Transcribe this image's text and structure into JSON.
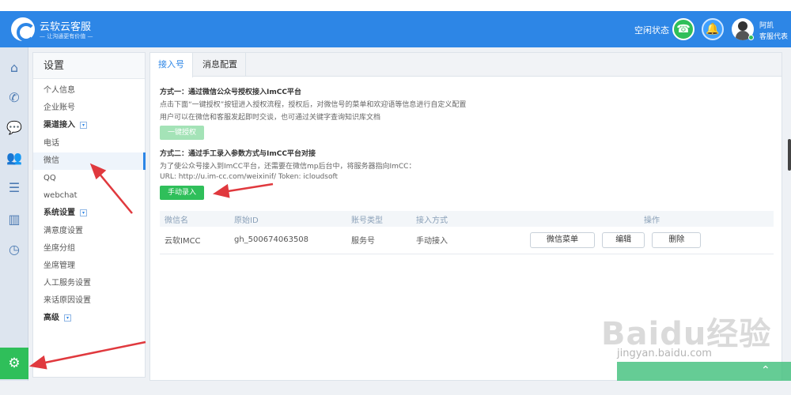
{
  "header": {
    "brand": "云软云客服",
    "slogan": "— 让沟通更有价值 —",
    "status": "空闲状态",
    "user_name": "阿凯",
    "user_role": "客服代表",
    "accent": "#2d86e6",
    "green": "#2fbf5a"
  },
  "rail": {
    "icons": [
      "home-icon",
      "phone-icon",
      "chat-icon",
      "users-icon",
      "list-icon",
      "chart-icon",
      "compass-icon",
      "gear-icon"
    ]
  },
  "sidebar": {
    "title": "设置",
    "items": [
      {
        "label": "个人信息"
      },
      {
        "label": "企业账号"
      },
      {
        "label": "渠道接入"
      },
      {
        "label": "电话"
      },
      {
        "label": "微信"
      },
      {
        "label": "QQ"
      },
      {
        "label": "webchat"
      },
      {
        "label": "系统设置"
      },
      {
        "label": "满意度设置"
      },
      {
        "label": "坐席分组"
      },
      {
        "label": "坐席管理"
      },
      {
        "label": "人工服务设置"
      },
      {
        "label": "来话原因设置"
      },
      {
        "label": "高级"
      }
    ]
  },
  "tabs": [
    {
      "label": "接入号"
    },
    {
      "label": "消息配置"
    }
  ],
  "method1": {
    "title": "方式一：通过微信公众号授权接入ImCC平台",
    "line1": "点击下面“一键授权”按钮进入授权流程，授权后，对微信号的菜单和欢迎语等信息进行自定义配置",
    "line2": "用户可以在微信和客服发起即时交谈，也可通过关键字查询知识库文档",
    "button": "一键授权"
  },
  "method2": {
    "title": "方式二：通过手工录入参数方式与ImCC平台对接",
    "line1": "为了使公众号接入到ImCC平台，还需要在微信mp后台中，将服务器指向ImCC：",
    "url": "URL: http://u.im-cc.com/weixinif/     Token: icloudsoft",
    "button": "手动录入"
  },
  "table": {
    "headers": [
      "微信名",
      "原始ID",
      "账号类型",
      "接入方式",
      "操作"
    ],
    "rows": [
      {
        "name": "云软IMCC",
        "id": "gh_500674063508",
        "type": "服务号",
        "mode": "手动接入"
      }
    ],
    "ops": [
      "微信菜单",
      "编辑",
      "删除"
    ]
  },
  "watermark": {
    "text": "Baidu经验",
    "sub": "jingyan.baidu.com"
  }
}
